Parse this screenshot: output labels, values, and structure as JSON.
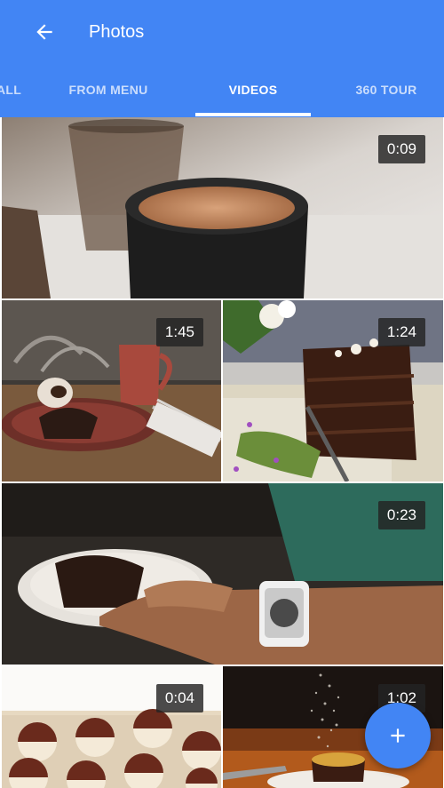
{
  "header": {
    "title": "Photos",
    "back_icon": "arrow-back-icon",
    "background": "#4285f4"
  },
  "tabs": [
    {
      "label": "ALL",
      "active": false
    },
    {
      "label": "FROM MENU",
      "active": false
    },
    {
      "label": "VIDEOS",
      "active": true
    },
    {
      "label": "360 TOUR",
      "active": false
    }
  ],
  "videos": [
    {
      "subject": "coffee cup",
      "duration": "0:09"
    },
    {
      "subject": "dessert with red mug",
      "duration": "1:45"
    },
    {
      "subject": "chocolate cake slice",
      "duration": "1:24"
    },
    {
      "subject": "hand with watch and cake",
      "duration": "0:23"
    },
    {
      "subject": "black and white cookies",
      "duration": "0:04"
    },
    {
      "subject": "dessert with sugar dust",
      "duration": "1:02"
    }
  ],
  "fab": {
    "icon": "plus-icon",
    "color": "#4285f4"
  }
}
